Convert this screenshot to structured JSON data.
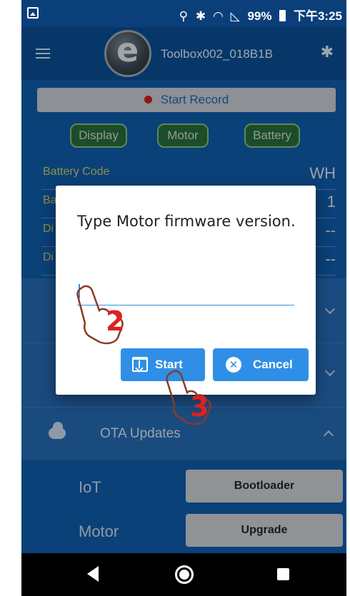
{
  "status_bar": {
    "battery": "99%",
    "time": "下午3:25"
  },
  "header": {
    "device_name": "Toolbox002_018B1B"
  },
  "record": {
    "label": "Start Record"
  },
  "tabs": [
    "Display",
    "Motor",
    "Battery"
  ],
  "fields": [
    {
      "label": "Battery Code",
      "value": "WH"
    },
    {
      "label": "Ba",
      "value": "1"
    },
    {
      "label": "Di",
      "value": "--"
    },
    {
      "label": "Di",
      "value": "--"
    }
  ],
  "ota": {
    "label": "OTA Updates"
  },
  "updates": [
    {
      "label": "IoT",
      "button": "Bootloader"
    },
    {
      "label": "Motor",
      "button": "Upgrade"
    }
  ],
  "dialog": {
    "message": "Type Motor firmware version.",
    "input_value": "",
    "start_label": "Start",
    "cancel_label": "Cancel"
  },
  "annotations": {
    "step_two": "2",
    "step_three": "3"
  },
  "colors": {
    "app_blue": "#0e5aa8",
    "accent_button": "#2f8fe6",
    "record_dot": "#cf1a1a",
    "annotation_red": "#e02020"
  }
}
